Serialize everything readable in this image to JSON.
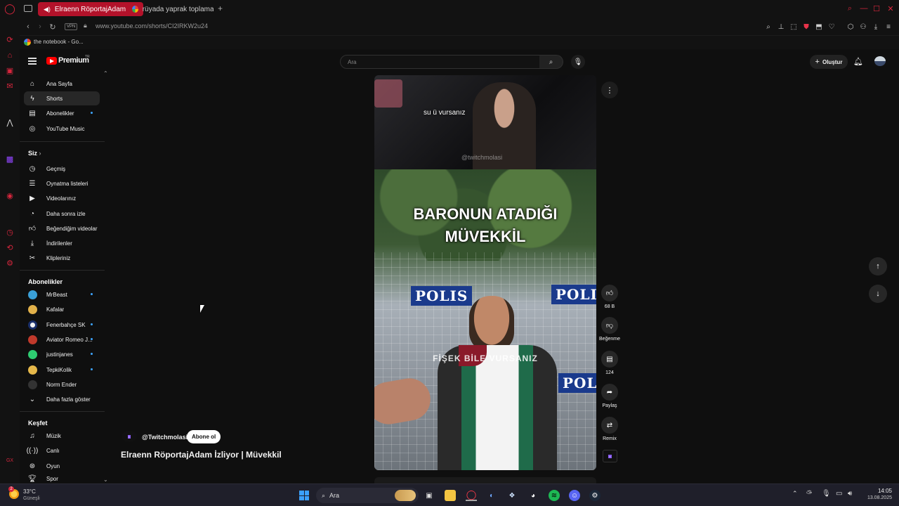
{
  "browser": {
    "tabs": [
      {
        "title": "Elraenn RöportajAdam",
        "active": true
      },
      {
        "title": "rüyada yaprak toplamak n",
        "active": false
      }
    ],
    "new_tab_label": "+",
    "vpn_label": "VPN",
    "url": "www.youtube.com/shorts/CI2IRKW2u24",
    "bookmark": "the notebook - Go..."
  },
  "yt": {
    "logo_text": "Premium",
    "logo_sup": "TR",
    "search_placeholder": "Ara",
    "create_label": "Oluştur",
    "nav": [
      {
        "label": "Ana Sayfa",
        "icon": "home-icon"
      },
      {
        "label": "Shorts",
        "icon": "shorts-icon",
        "active": true
      },
      {
        "label": "Abonelikler",
        "icon": "subscriptions-icon",
        "dot": true
      },
      {
        "label": "YouTube Music",
        "icon": "music-icon"
      }
    ],
    "you_heading": "Siz",
    "you_items": [
      {
        "label": "Geçmiş"
      },
      {
        "label": "Oynatma listeleri"
      },
      {
        "label": "Videolarınız"
      },
      {
        "label": "Daha sonra izle"
      },
      {
        "label": "Beğendiğim videolar"
      },
      {
        "label": "İndirilenler"
      },
      {
        "label": "Klipleriniz"
      }
    ],
    "subs_heading": "Abonelikler",
    "subs": [
      {
        "label": "MrBeast",
        "dot": true,
        "color": "#3aa0d8"
      },
      {
        "label": "Kafalar",
        "dot": false,
        "color": "#e2b14a"
      },
      {
        "label": "Fenerbahçe SK",
        "dot": true,
        "color": "#f3f3f3"
      },
      {
        "label": "Aviator Romeo J...",
        "dot": true,
        "color": "#c0392b"
      },
      {
        "label": "justinjanes",
        "dot": true,
        "color": "#2ecc71"
      },
      {
        "label": "TepkiKolik",
        "dot": true,
        "color": "#e6b84a"
      },
      {
        "label": "Norm Ender",
        "dot": false,
        "color": "#333333"
      }
    ],
    "show_more": "Daha fazla göster",
    "explore_heading": "Keşfet",
    "explore": [
      {
        "label": "Müzik"
      },
      {
        "label": "Canlı"
      },
      {
        "label": "Oyun"
      },
      {
        "label": "Spor"
      }
    ],
    "short": {
      "top_caption": "su ü vursanız",
      "watermark": "@twitchmolasi",
      "headline_line1": "BARONUN ATADIĞI",
      "headline_line2": "MÜVEKKİL",
      "polis": "POLIS",
      "subtitle": "FİŞEK BİLE VURSANIZ",
      "channel": "@Twitchmolasi",
      "subscribe": "Abone ol",
      "title": "Elraenn RöportajAdam İzliyor | Müvekkil",
      "likes": "68 B",
      "dislike_label": "Beğenme",
      "comments": "124",
      "share_label": "Paylaş",
      "remix_label": "Remix"
    }
  },
  "taskbar": {
    "weather_temp": "33°C",
    "weather_desc": "Güneşli",
    "search_label": "Ara",
    "time": "14:05",
    "date": "13.08.2025",
    "badge": "2"
  }
}
